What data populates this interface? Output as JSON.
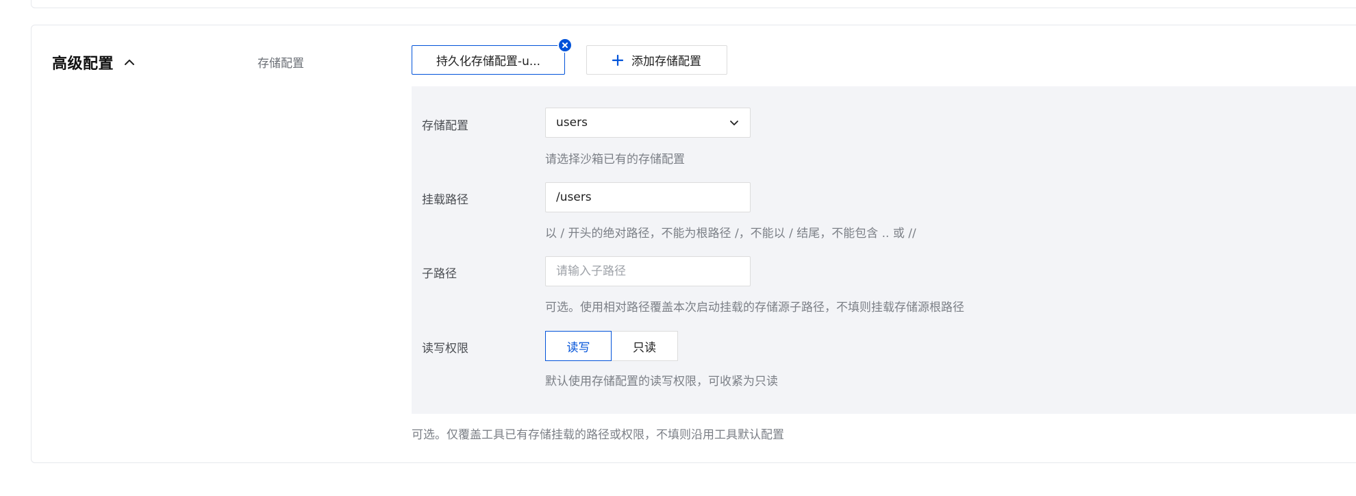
{
  "section": {
    "title": "高级配置",
    "storage_label": "存储配置"
  },
  "tabs": {
    "active_label": "持久化存储配置-u...",
    "add_label": "添加存储配置"
  },
  "form": {
    "storage": {
      "label": "存储配置",
      "value": "users",
      "help": "请选择沙箱已有的存储配置"
    },
    "mount_path": {
      "label": "挂载路径",
      "value": "/users",
      "help": "以 / 开头的绝对路径，不能为根路径 /，不能以 / 结尾，不能包含 .. 或 //"
    },
    "sub_path": {
      "label": "子路径",
      "placeholder": "请输入子路径",
      "help": "可选。使用相对路径覆盖本次启动挂载的存储源子路径，不填则挂载存储源根路径"
    },
    "permission": {
      "label": "读写权限",
      "options": [
        "读写",
        "只读"
      ],
      "selected": "读写",
      "help": "默认使用存储配置的读写权限，可收紧为只读"
    }
  },
  "bottom_help": "可选。仅覆盖工具已有存储挂载的路径或权限，不填则沿用工具默认配置",
  "colors": {
    "accent": "#0052d9",
    "panel_bg": "#f3f4f7",
    "border": "#dcdcdc",
    "help_text": "#7b7f86"
  },
  "icons": {
    "collapse": "chevron-up-icon",
    "close": "close-circle-icon",
    "add": "plus-icon",
    "dropdown": "chevron-down-icon"
  }
}
